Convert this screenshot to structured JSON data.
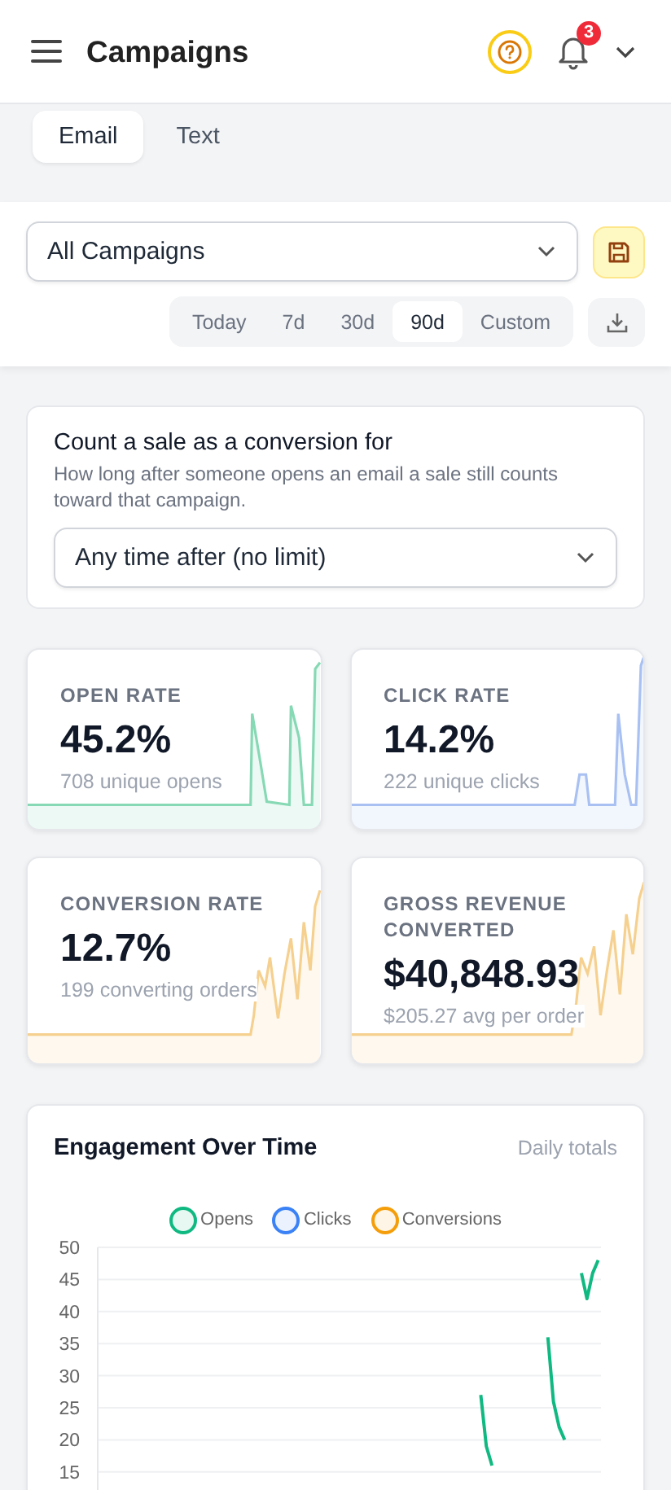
{
  "header": {
    "title": "Campaigns",
    "notification_count": "3"
  },
  "tabs": [
    {
      "label": "Email",
      "selected": true
    },
    {
      "label": "Text",
      "selected": false
    }
  ],
  "filters": {
    "campaign_select": {
      "value": "All Campaigns"
    },
    "ranges": [
      {
        "label": "Today",
        "selected": false
      },
      {
        "label": "7d",
        "selected": false
      },
      {
        "label": "30d",
        "selected": false
      },
      {
        "label": "90d",
        "selected": true
      },
      {
        "label": "Custom",
        "selected": false
      }
    ]
  },
  "conversion_window": {
    "title": "Count a sale as a conversion for",
    "description": "How long after someone opens an email a sale still counts toward that campaign.",
    "select": {
      "value": "Any time after (no limit)"
    }
  },
  "metrics": [
    {
      "label": "OPEN RATE",
      "value": "45.2%",
      "caption": "708 unique opens",
      "color": "#86d9b4"
    },
    {
      "label": "CLICK RATE",
      "value": "14.2%",
      "caption": "222 unique clicks",
      "color": "#a9c1f2"
    },
    {
      "label": "CONVERSION RATE",
      "value": "12.7%",
      "caption": "199 converting orders",
      "color": "#f5d08f"
    },
    {
      "label": "GROSS REVENUE CONVERTED",
      "value": "$40,848.93",
      "caption": "$205.27 avg per order",
      "color": "#f5d08f"
    }
  ],
  "engagement": {
    "title": "Engagement Over Time",
    "subtitle": "Daily totals",
    "chart_data": {
      "type": "line",
      "grid": true,
      "ylim": [
        0,
        50
      ],
      "yticks": [
        15,
        20,
        25,
        30,
        35,
        40,
        45,
        50
      ],
      "series": [
        {
          "name": "Opens",
          "color": "#10b981",
          "values": [
            null,
            null,
            null,
            null,
            null,
            null,
            null,
            null,
            null,
            null,
            null,
            null,
            null,
            null,
            null,
            null,
            null,
            null,
            null,
            null,
            null,
            null,
            null,
            null,
            null,
            null,
            null,
            null,
            null,
            null,
            null,
            null,
            null,
            null,
            null,
            null,
            null,
            null,
            null,
            null,
            null,
            null,
            null,
            null,
            null,
            null,
            null,
            null,
            null,
            null,
            null,
            null,
            null,
            null,
            null,
            null,
            null,
            null,
            null,
            null,
            null,
            null,
            null,
            null,
            null,
            null,
            null,
            null,
            27,
            19,
            16,
            null,
            null,
            null,
            null,
            null,
            null,
            null,
            null,
            null,
            36,
            26,
            22,
            20,
            null,
            null,
            46,
            42,
            46,
            48
          ]
        },
        {
          "name": "Clicks",
          "color": "#3b82f6"
        },
        {
          "name": "Conversions",
          "color": "#f59e0b"
        }
      ]
    }
  }
}
